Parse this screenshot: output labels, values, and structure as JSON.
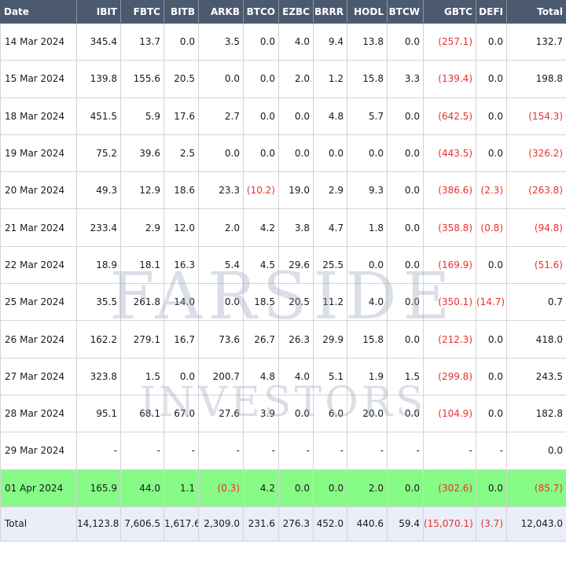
{
  "table": {
    "headers": [
      "Date",
      "IBIT",
      "FBTC",
      "BITB",
      "ARKB",
      "BTCO",
      "EZBC",
      "BRRR",
      "HODL",
      "BTCW",
      "GBTC",
      "DEFI",
      "Total"
    ],
    "rows": [
      {
        "highlight": false,
        "cells": [
          "14 Mar 2024",
          "345.4",
          "13.7",
          "0.0",
          "3.5",
          "0.0",
          "4.0",
          "9.4",
          "13.8",
          "0.0",
          "(257.1)",
          "0.0",
          "132.7"
        ]
      },
      {
        "highlight": false,
        "cells": [
          "15 Mar 2024",
          "139.8",
          "155.6",
          "20.5",
          "0.0",
          "0.0",
          "2.0",
          "1.2",
          "15.8",
          "3.3",
          "(139.4)",
          "0.0",
          "198.8"
        ]
      },
      {
        "highlight": false,
        "cells": [
          "18 Mar 2024",
          "451.5",
          "5.9",
          "17.6",
          "2.7",
          "0.0",
          "0.0",
          "4.8",
          "5.7",
          "0.0",
          "(642.5)",
          "0.0",
          "(154.3)"
        ]
      },
      {
        "highlight": false,
        "cells": [
          "19 Mar 2024",
          "75.2",
          "39.6",
          "2.5",
          "0.0",
          "0.0",
          "0.0",
          "0.0",
          "0.0",
          "0.0",
          "(443.5)",
          "0.0",
          "(326.2)"
        ]
      },
      {
        "highlight": false,
        "cells": [
          "20 Mar 2024",
          "49.3",
          "12.9",
          "18.6",
          "23.3",
          "(10.2)",
          "19.0",
          "2.9",
          "9.3",
          "0.0",
          "(386.6)",
          "(2.3)",
          "(263.8)"
        ]
      },
      {
        "highlight": false,
        "cells": [
          "21 Mar 2024",
          "233.4",
          "2.9",
          "12.0",
          "2.0",
          "4.2",
          "3.8",
          "4.7",
          "1.8",
          "0.0",
          "(358.8)",
          "(0.8)",
          "(94.8)"
        ]
      },
      {
        "highlight": false,
        "cells": [
          "22 Mar 2024",
          "18.9",
          "18.1",
          "16.3",
          "5.4",
          "4.5",
          "29.6",
          "25.5",
          "0.0",
          "0.0",
          "(169.9)",
          "0.0",
          "(51.6)"
        ]
      },
      {
        "highlight": false,
        "cells": [
          "25 Mar 2024",
          "35.5",
          "261.8",
          "14.0",
          "0.0",
          "18.5",
          "20.5",
          "11.2",
          "4.0",
          "0.0",
          "(350.1)",
          "(14.7)",
          "0.7"
        ]
      },
      {
        "highlight": false,
        "cells": [
          "26 Mar 2024",
          "162.2",
          "279.1",
          "16.7",
          "73.6",
          "26.7",
          "26.3",
          "29.9",
          "15.8",
          "0.0",
          "(212.3)",
          "0.0",
          "418.0"
        ]
      },
      {
        "highlight": false,
        "cells": [
          "27 Mar 2024",
          "323.8",
          "1.5",
          "0.0",
          "200.7",
          "4.8",
          "4.0",
          "5.1",
          "1.9",
          "1.5",
          "(299.8)",
          "0.0",
          "243.5"
        ]
      },
      {
        "highlight": false,
        "cells": [
          "28 Mar 2024",
          "95.1",
          "68.1",
          "67.0",
          "27.6",
          "3.9",
          "0.0",
          "6.0",
          "20.0",
          "0.0",
          "(104.9)",
          "0.0",
          "182.8"
        ]
      },
      {
        "highlight": false,
        "cells": [
          "29 Mar 2024",
          "-",
          "-",
          "-",
          "-",
          "-",
          "-",
          "-",
          "-",
          "-",
          "-",
          "-",
          "0.0"
        ]
      },
      {
        "highlight": true,
        "cells": [
          "01 Apr 2024",
          "165.9",
          "44.0",
          "1.1",
          "(0.3)",
          "4.2",
          "0.0",
          "0.0",
          "2.0",
          "0.0",
          "(302.6)",
          "0.0",
          "(85.7)"
        ]
      }
    ],
    "total": [
      "Total",
      "14,123.8",
      "7,606.5",
      "1,617.6",
      "2,309.0",
      "231.6",
      "276.3",
      "452.0",
      "440.6",
      "59.4",
      "(15,070.1)",
      "(3.7)",
      "12,043.0"
    ]
  },
  "watermark": {
    "line1": "FARSIDE",
    "line2": "INVESTORS"
  },
  "colors": {
    "header_bg": "#4c5a70",
    "negative": "#e8302f",
    "highlight_row": "#86fb86",
    "total_row": "#e9eef8"
  }
}
